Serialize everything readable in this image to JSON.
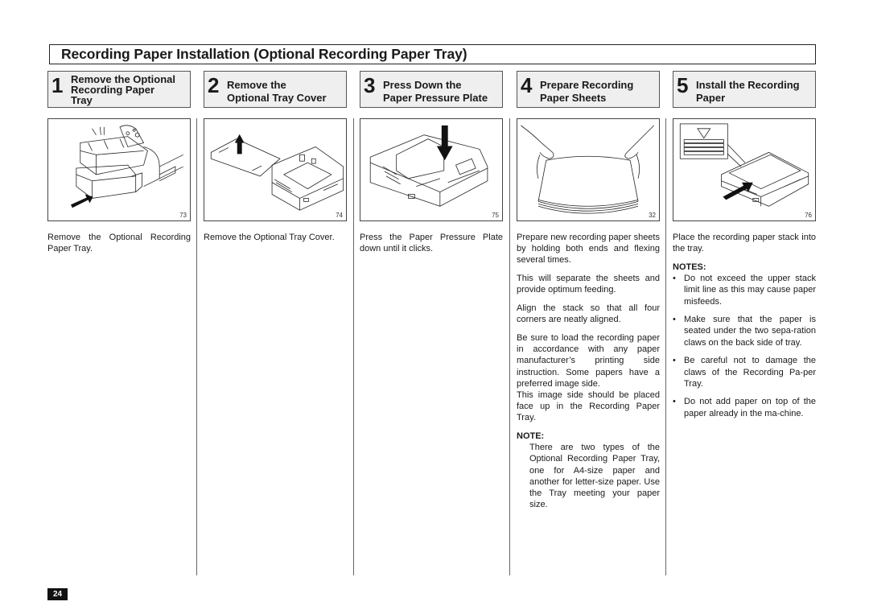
{
  "page_title": "Recording Paper Installation (Optional Recording Paper Tray)",
  "steps": [
    {
      "number": "1",
      "title_lines": [
        "Remove the Optional",
        "Recording Paper",
        "Tray"
      ],
      "figure_number": "73",
      "figure_icon": "remove-tray-illustration",
      "paragraphs": [
        "Remove the Optional Recording Paper Tray."
      ]
    },
    {
      "number": "2",
      "title_lines": [
        "Remove the",
        "Optional Tray Cover"
      ],
      "figure_number": "74",
      "figure_icon": "remove-cover-illustration",
      "paragraphs": [
        "Remove the Optional Tray Cover."
      ]
    },
    {
      "number": "3",
      "title_lines": [
        "Press Down the",
        "Paper Pressure Plate"
      ],
      "figure_number": "75",
      "figure_icon": "press-plate-illustration",
      "paragraphs": [
        "Press the Paper Pressure Plate down until it clicks."
      ]
    },
    {
      "number": "4",
      "title_lines": [
        "Prepare Recording",
        "Paper Sheets"
      ],
      "figure_number": "32",
      "figure_icon": "flex-paper-illustration",
      "paragraphs": [
        "Prepare new recording paper sheets by holding both ends and flexing several times.",
        "This will separate the sheets and provide optimum feeding.",
        "Align the stack so that all four corners are neatly aligned.",
        "Be sure to load the recording paper in accordance with any paper manufacturer’s printing side instruction. Some papers have a preferred image side.",
        "This image side should be placed face up in the Recording Paper Tray."
      ],
      "note_heading": "NOTE:",
      "note_text": "There are two types of the Optional Recording Paper Tray, one for A4-size paper and another for letter-size paper. Use the Tray meeting your paper size."
    },
    {
      "number": "5",
      "title_lines": [
        "Install the Recording",
        "Paper"
      ],
      "figure_number": "76",
      "figure_icon": "install-paper-illustration",
      "paragraphs": [
        "Place the recording paper stack into the tray."
      ],
      "notes_heading": "NOTES:",
      "notes": [
        "Do not exceed the upper stack limit line as this may cause paper misfeeds.",
        "Make sure that the paper is seated under the two sepa-ration claws on the back side of tray.",
        "Be careful not to damage the claws of the Recording Pa-per Tray.",
        "Do not add paper on top of the paper already in the ma-chine."
      ]
    }
  ],
  "page_number": "24"
}
